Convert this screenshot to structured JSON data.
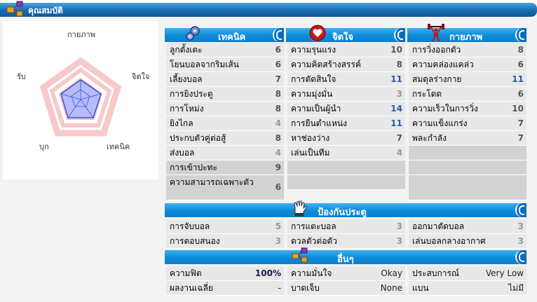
{
  "header": {
    "title": "คุณสมบัติ",
    "icon": "attributes-icon"
  },
  "radar": {
    "labels": {
      "top": "กายภาพ",
      "right": "จิตใจ",
      "bottom_right": "เทคนิค",
      "bottom_left": "บุก",
      "left": "รับ"
    },
    "colors": {
      "outer": "#f7c9c9",
      "inner": "#b0b8ff",
      "stroke": "#1a3ccc"
    }
  },
  "technical": {
    "title": "เทคนิค",
    "icon": "gears-icon",
    "rows": [
      {
        "label": "ลูกตั้งเตะ",
        "value": "6"
      },
      {
        "label": "โยนบอลจากริมเส้น",
        "value": "6"
      },
      {
        "label": "เลี้ยงบอล",
        "value": "7"
      },
      {
        "label": "การยิงประตู",
        "value": "8"
      },
      {
        "label": "การโหม่ง",
        "value": "8"
      },
      {
        "label": "ยิงไกล",
        "value": "4"
      },
      {
        "label": "ประกบตัวคู่ต่อสู้",
        "value": "8"
      },
      {
        "label": "ส่งบอล",
        "value": "4"
      },
      {
        "label": "การเข้าปะทะ",
        "value": "9"
      },
      {
        "label": "ความสามารถเฉพาะตัว",
        "value": "6"
      }
    ]
  },
  "mental": {
    "title": "จิตใจ",
    "icon": "heart-icon",
    "rows": [
      {
        "label": "ความรุนแรง",
        "value": "10"
      },
      {
        "label": "ความคิดสร้างสรรค์",
        "value": "8"
      },
      {
        "label": "การตัดสินใจ",
        "value": "11"
      },
      {
        "label": "ความมุ่งมั่น",
        "value": "3"
      },
      {
        "label": "ความเป็นผู้นำ",
        "value": "14"
      },
      {
        "label": "การยืนตำแหน่ง",
        "value": "11"
      },
      {
        "label": "หาช่องว่าง",
        "value": "7"
      },
      {
        "label": "เล่นเป็นทีม",
        "value": "4"
      }
    ]
  },
  "physical": {
    "title": "กายภาพ",
    "icon": "weightlifter-icon",
    "rows": [
      {
        "label": "การวิ่งออกตัว",
        "value": "8"
      },
      {
        "label": "ความคล่องแคล่ว",
        "value": "6"
      },
      {
        "label": "สมดุลร่างกาย",
        "value": "11"
      },
      {
        "label": "กระโดด",
        "value": "6"
      },
      {
        "label": "ความเร็วในการวิ่ง",
        "value": "10"
      },
      {
        "label": "ความแข็งแกร่ง",
        "value": "7"
      },
      {
        "label": "พละกำลัง",
        "value": "7"
      }
    ]
  },
  "goalkeeping": {
    "title": "ป้องกันประตู",
    "icon": "goalkeeper-glove-icon",
    "rows": [
      [
        {
          "label": "การจับบอล",
          "value": "5"
        },
        {
          "label": "การแตะบอล",
          "value": "3"
        },
        {
          "label": "ออกมาตัดบอล",
          "value": "3"
        }
      ],
      [
        {
          "label": "การตอบสนอง",
          "value": "3"
        },
        {
          "label": "ดวลตัวต่อตัว",
          "value": "3"
        },
        {
          "label": "เล่นบอลกลางอากาศ",
          "value": "3"
        }
      ]
    ]
  },
  "other": {
    "title": "อื่นๆ",
    "icon": "misc-icon",
    "rows": [
      [
        {
          "label": "ความฟิต",
          "value": "100%"
        },
        {
          "label": "ความมั่นใจ",
          "value": "Okay"
        },
        {
          "label": "ประสบการณ์",
          "value": "Very Low"
        }
      ],
      [
        {
          "label": "ผลงานเฉลี่ย",
          "value": "-"
        },
        {
          "label": "บาดเจ็บ",
          "value": "None"
        },
        {
          "label": "แบน",
          "value": "ไม่มี"
        }
      ]
    ]
  }
}
